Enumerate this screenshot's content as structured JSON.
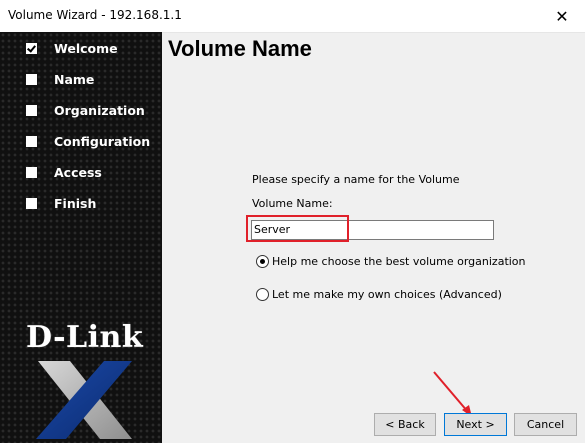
{
  "window": {
    "title": "Volume Wizard - 192.168.1.1",
    "close_glyph": "✕"
  },
  "sidebar": {
    "steps": [
      {
        "label": "Welcome",
        "checked": true
      },
      {
        "label": "Name",
        "checked": false
      },
      {
        "label": "Organization",
        "checked": false
      },
      {
        "label": "Configuration",
        "checked": false
      },
      {
        "label": "Access",
        "checked": false
      },
      {
        "label": "Finish",
        "checked": false
      }
    ],
    "logo_text": "D-Link"
  },
  "main": {
    "heading": "Volume Name",
    "prompt": "Please specify a name for the Volume",
    "volume_label": "Volume Name:",
    "volume_value": "Server",
    "options": [
      {
        "label": "Help me choose the best volume organization",
        "selected": true
      },
      {
        "label": "Let me make my own choices (Advanced)",
        "selected": false
      }
    ]
  },
  "buttons": {
    "back": "< Back",
    "next": "Next >",
    "cancel": "Cancel"
  },
  "colors": {
    "highlight": "#e0202a",
    "sidebar_bg": "#101010"
  }
}
